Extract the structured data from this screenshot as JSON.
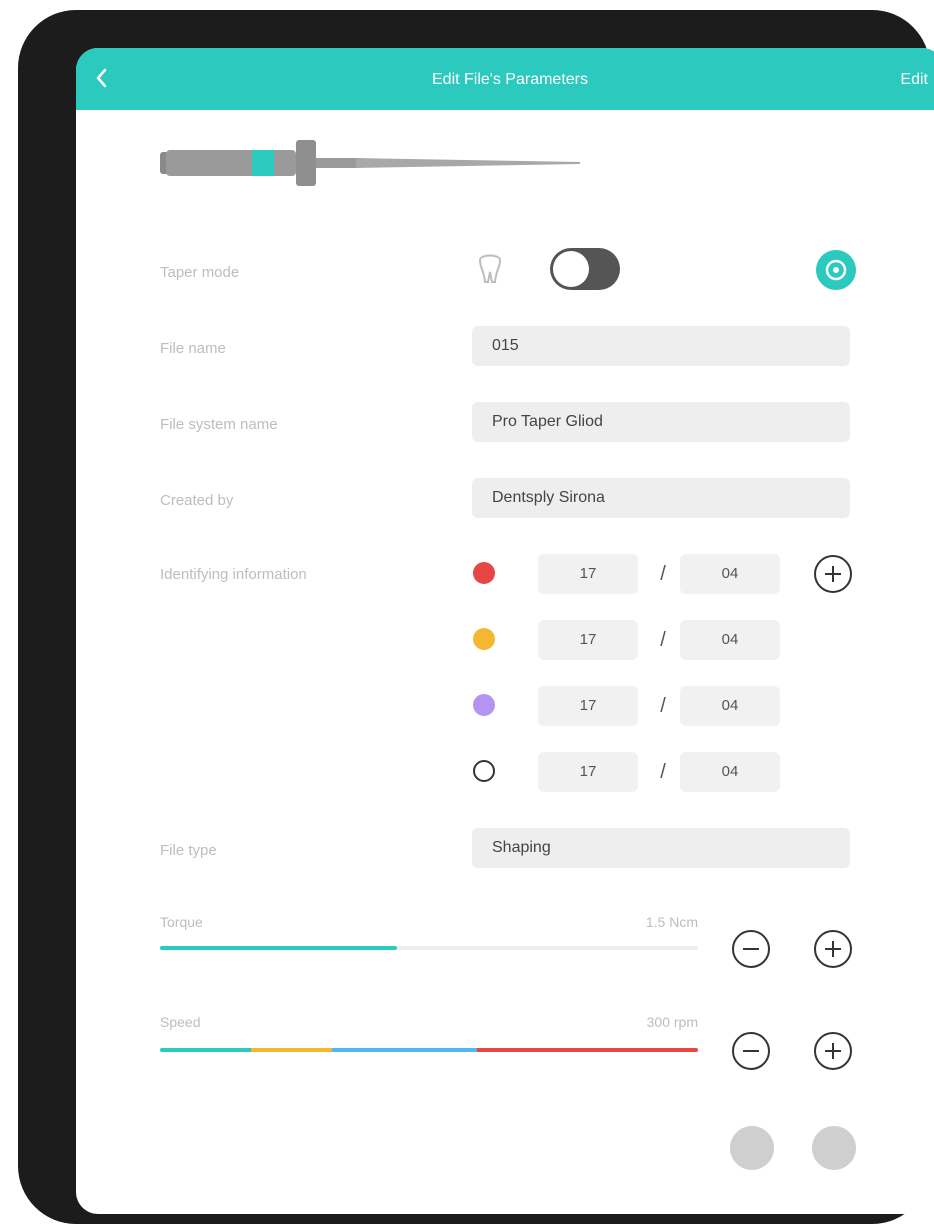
{
  "navbar": {
    "title": "Edit File's Parameters",
    "action_label": "Edit"
  },
  "fields": {
    "toggle_row_label": "Taper mode",
    "file_name_label": "File name",
    "file_name_value": "015",
    "system_name_label": "File system name",
    "system_name_value": "Pro Taper Gliod",
    "created_by_label": "Created by",
    "created_by_value": "Dentsply Sirona",
    "identifying_label": "Identifying information",
    "file_type_label": "File type",
    "file_type_value": "Shaping"
  },
  "identifiers": [
    {
      "color": "#e84545",
      "size": "17",
      "taper": "04"
    },
    {
      "color": "#f5b731",
      "size": "17",
      "taper": "04"
    },
    {
      "color": "#b394f0",
      "size": "17",
      "taper": "04"
    },
    {
      "color": "#ffffff",
      "size": "17",
      "taper": "04"
    }
  ],
  "separator": "/",
  "sliders": {
    "torque": {
      "label": "Torque",
      "value_text": "1.5 Ncm",
      "fraction": 0.44
    },
    "speed": {
      "label": "Speed",
      "value_text": "300 rpm"
    }
  },
  "colors": {
    "accent": "#2cc9bf",
    "speed_segments": [
      "#2cc9bf",
      "#f5b731",
      "#4fb8ef",
      "#e84545"
    ]
  },
  "icons": {
    "back": "chevron-left-icon",
    "tooth": "tooth-icon",
    "settings": "teal-circle-icon",
    "add": "plus-circle-icon",
    "remove": "minus-circle-icon"
  }
}
